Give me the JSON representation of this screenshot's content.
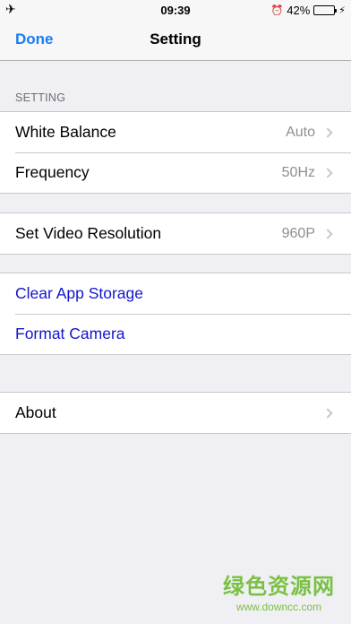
{
  "status_bar": {
    "time": "09:39",
    "battery_percent": "42%",
    "battery_level": 0.42,
    "airplane_icon": "airplane-icon",
    "alarm_icon": "alarm-icon",
    "charging_icon": "bolt-icon"
  },
  "nav": {
    "done_label": "Done",
    "title": "Setting"
  },
  "section": {
    "header": "SETTING"
  },
  "rows": {
    "white_balance": {
      "label": "White Balance",
      "value": "Auto"
    },
    "frequency": {
      "label": "Frequency",
      "value": "50Hz"
    },
    "video_resolution": {
      "label": "Set Video Resolution",
      "value": "960P"
    },
    "clear_storage": {
      "label": "Clear App Storage"
    },
    "format_camera": {
      "label": "Format Camera"
    },
    "about": {
      "label": "About"
    }
  },
  "watermark": {
    "text": "绿色资源网",
    "url": "www.downcc.com"
  },
  "colors": {
    "accent": "#1a7cf5",
    "action_text": "#1515cc",
    "background": "#efeff4",
    "battery": "#4cd964"
  }
}
